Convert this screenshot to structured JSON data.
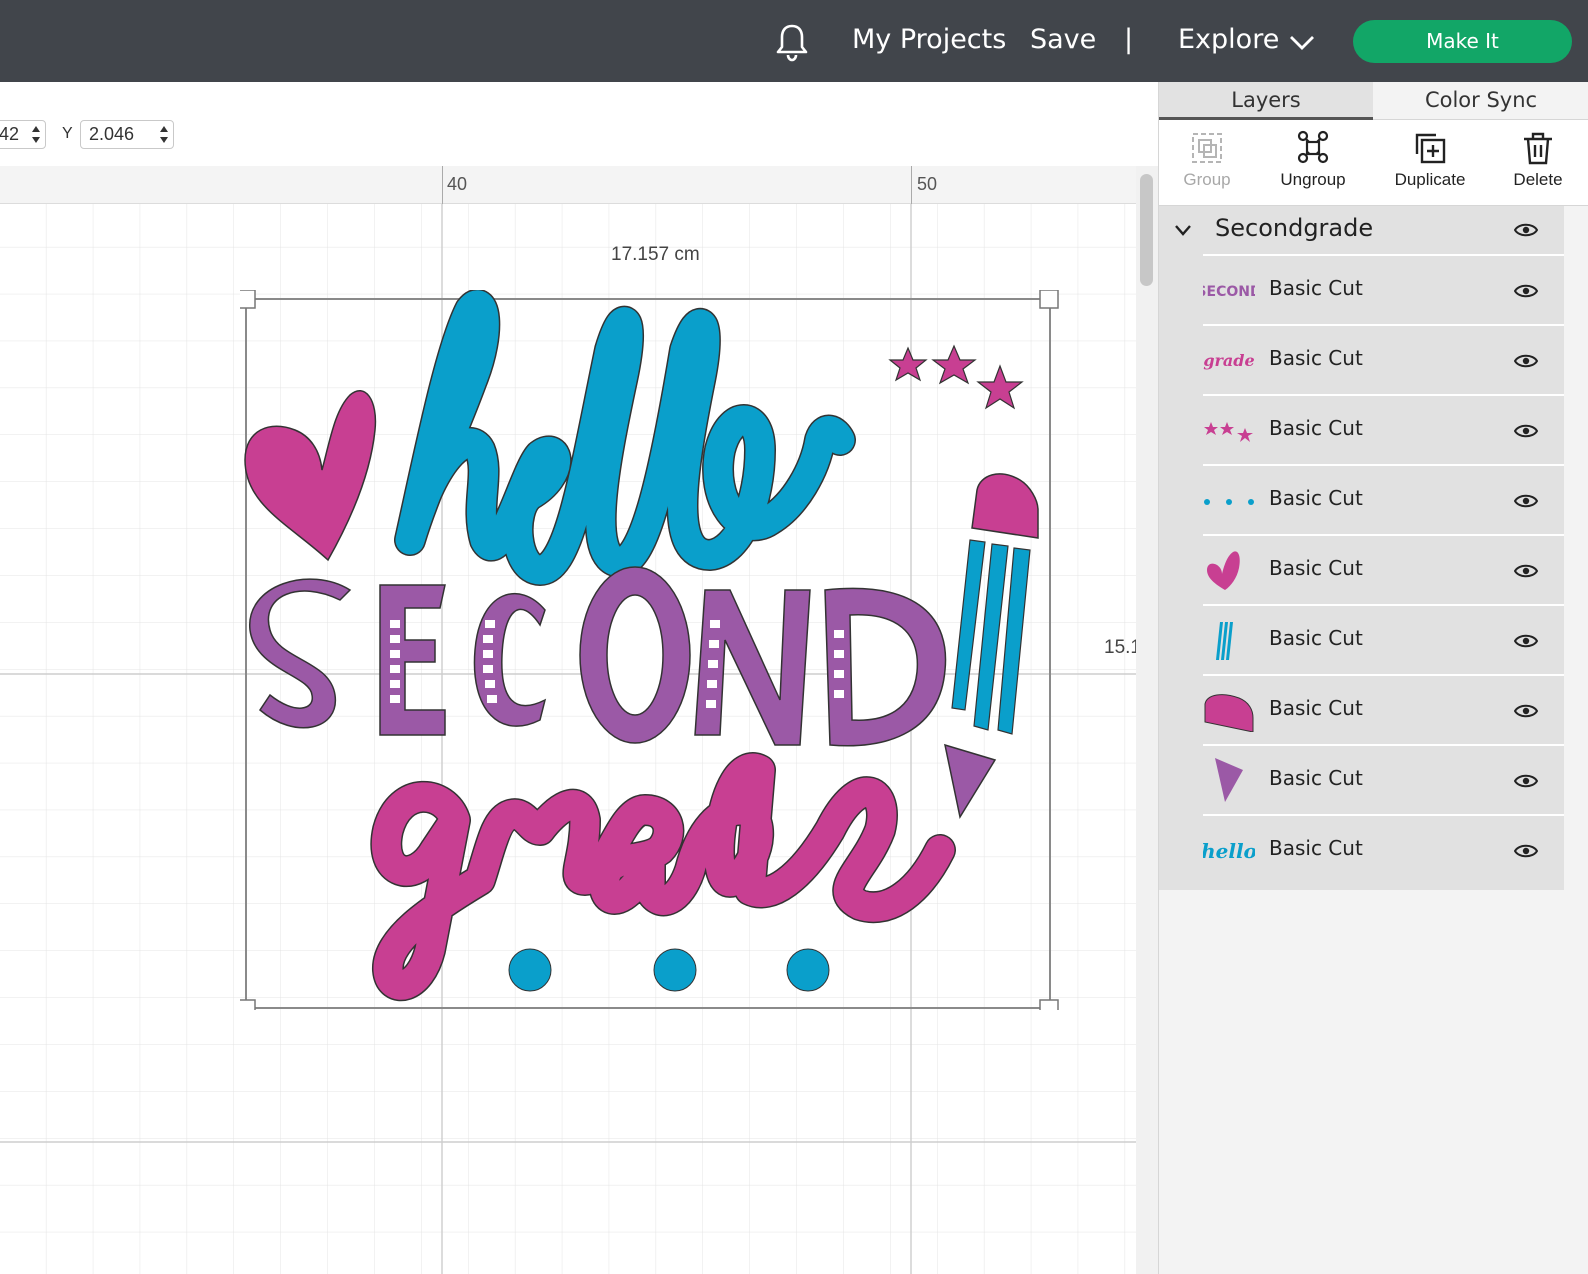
{
  "topbar": {
    "my_projects": "My Projects",
    "save": "Save",
    "separator": "|",
    "explore": "Explore",
    "make_it": "Make It",
    "accent_color": "#12a667",
    "bg_color": "#41454b",
    "icons": [
      "bell-icon",
      "chevron-down-icon"
    ]
  },
  "position": {
    "x_value": "42",
    "y_label": "Y",
    "y_value": "2.046"
  },
  "ruler": {
    "labels": [
      "40",
      "50"
    ]
  },
  "canvas": {
    "width_label": "17.157 cm",
    "height_label": "15.1"
  },
  "design": {
    "words": [
      "hello",
      "SECOND",
      "grade"
    ],
    "colors": {
      "blue": "#0a9fcb",
      "purple": "#9b59a6",
      "pink": "#c83f92"
    }
  },
  "sidebar": {
    "tabs": [
      "Layers",
      "Color Sync"
    ],
    "tools": [
      "Group",
      "Ungroup",
      "Duplicate",
      "Delete"
    ],
    "group_name": "Secondgrade",
    "layers": [
      {
        "label": "Basic Cut",
        "thumb_text": "SECOND"
      },
      {
        "label": "Basic Cut",
        "thumb_text": "grade"
      },
      {
        "label": "Basic Cut"
      },
      {
        "label": "Basic Cut"
      },
      {
        "label": "Basic Cut"
      },
      {
        "label": "Basic Cut"
      },
      {
        "label": "Basic Cut"
      },
      {
        "label": "Basic Cut"
      },
      {
        "label": "Basic Cut",
        "thumb_text": "hello"
      }
    ]
  }
}
